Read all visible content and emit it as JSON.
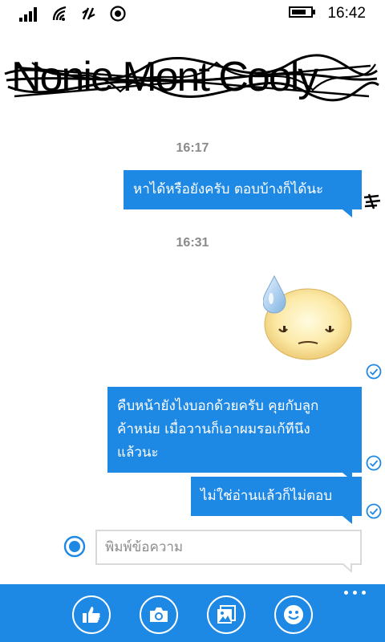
{
  "status_bar": {
    "time": "16:42",
    "icons": [
      "signal-icon",
      "wifi-icon",
      "data-sync-icon",
      "location-icon",
      "battery-icon"
    ]
  },
  "header": {
    "title_scribbled": "Nonie Mont Cooly"
  },
  "messages": [
    {
      "type": "timestamp",
      "text": "16:17"
    },
    {
      "type": "text",
      "text": "หาได้หรือยังครับ ตอบบ้างก็ได้นะ"
    },
    {
      "type": "timestamp",
      "text": "16:31"
    },
    {
      "type": "sticker",
      "icon": "sweat-face-sticker",
      "status": "sent-check-icon"
    },
    {
      "type": "text",
      "lines": [
        "คืบหน้ายังไงบอกด้วยครับ คุยกับลูก",
        "ค้าหน่ย เมื่อวานก็เอาผมรอเก้ทีนึง",
        "แล้วนะ"
      ],
      "status": "sent-check-icon"
    },
    {
      "type": "text",
      "text": "ไม่ใช่อ่านแล้วก็ไม่ตอบ",
      "status": "sent-check-icon"
    }
  ],
  "composer": {
    "placeholder": "พิมพ์ข้อความ",
    "value": ""
  },
  "app_bar": {
    "buttons": [
      "like-icon",
      "camera-icon",
      "photo-gallery-icon",
      "emoji-icon"
    ],
    "more": "more-dots-icon"
  },
  "colors": {
    "accent": "#1e88e5",
    "timestamp": "#8a8a8a",
    "input_border": "#d9d9d9"
  }
}
